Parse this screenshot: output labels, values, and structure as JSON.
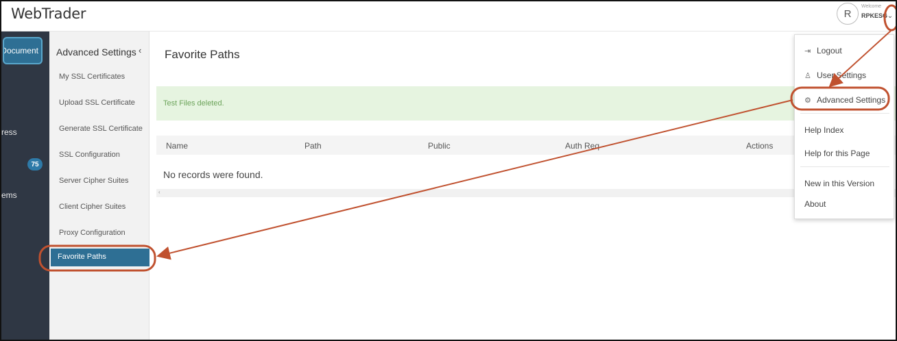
{
  "app": {
    "title": "WebTrader"
  },
  "header": {
    "avatar_initial": "R",
    "welcome_label": "Welcome",
    "username": "RPKESG",
    "chevron": "⌄"
  },
  "rail": {
    "active_button": "Document",
    "labels": [
      "ress",
      "ems"
    ],
    "badge_count": "75"
  },
  "subnav": {
    "title": "Advanced Settings",
    "collapse_glyph": "‹",
    "items": [
      {
        "label": "My SSL Certificates"
      },
      {
        "label": "Upload SSL Certificate"
      },
      {
        "label": "Generate SSL Certificate"
      },
      {
        "label": "SSL Configuration"
      },
      {
        "label": "Server Cipher Suites"
      },
      {
        "label": "Client Cipher Suites"
      },
      {
        "label": "Proxy Configuration"
      },
      {
        "label": "Favorite Paths",
        "active": true
      }
    ]
  },
  "main": {
    "page_title": "Favorite Paths",
    "alert_text": "Test Files deleted.",
    "table": {
      "columns": [
        "Name",
        "Path",
        "Public",
        "Auth Req",
        "Actions"
      ],
      "empty_text": "No records were found."
    },
    "scroll_arrow": "‹"
  },
  "user_menu": {
    "items": [
      {
        "label": "Logout",
        "icon": "logout-icon",
        "glyph": "⇥"
      },
      {
        "label": "User Settings",
        "icon": "user-icon",
        "glyph": "♙"
      },
      {
        "label": "Advanced Settings",
        "icon": "gear-icon",
        "glyph": "⚙"
      },
      {
        "label": "Help Index"
      },
      {
        "label": "Help for this Page"
      },
      {
        "label": "New in this Version"
      },
      {
        "label": "About"
      }
    ]
  },
  "annotation": {
    "color": "#c0512f"
  },
  "colors": {
    "rail_bg": "#2f3744",
    "active_blue": "#2e6f94",
    "alert_bg": "#e6f4e0",
    "alert_text": "#6ca35a"
  }
}
